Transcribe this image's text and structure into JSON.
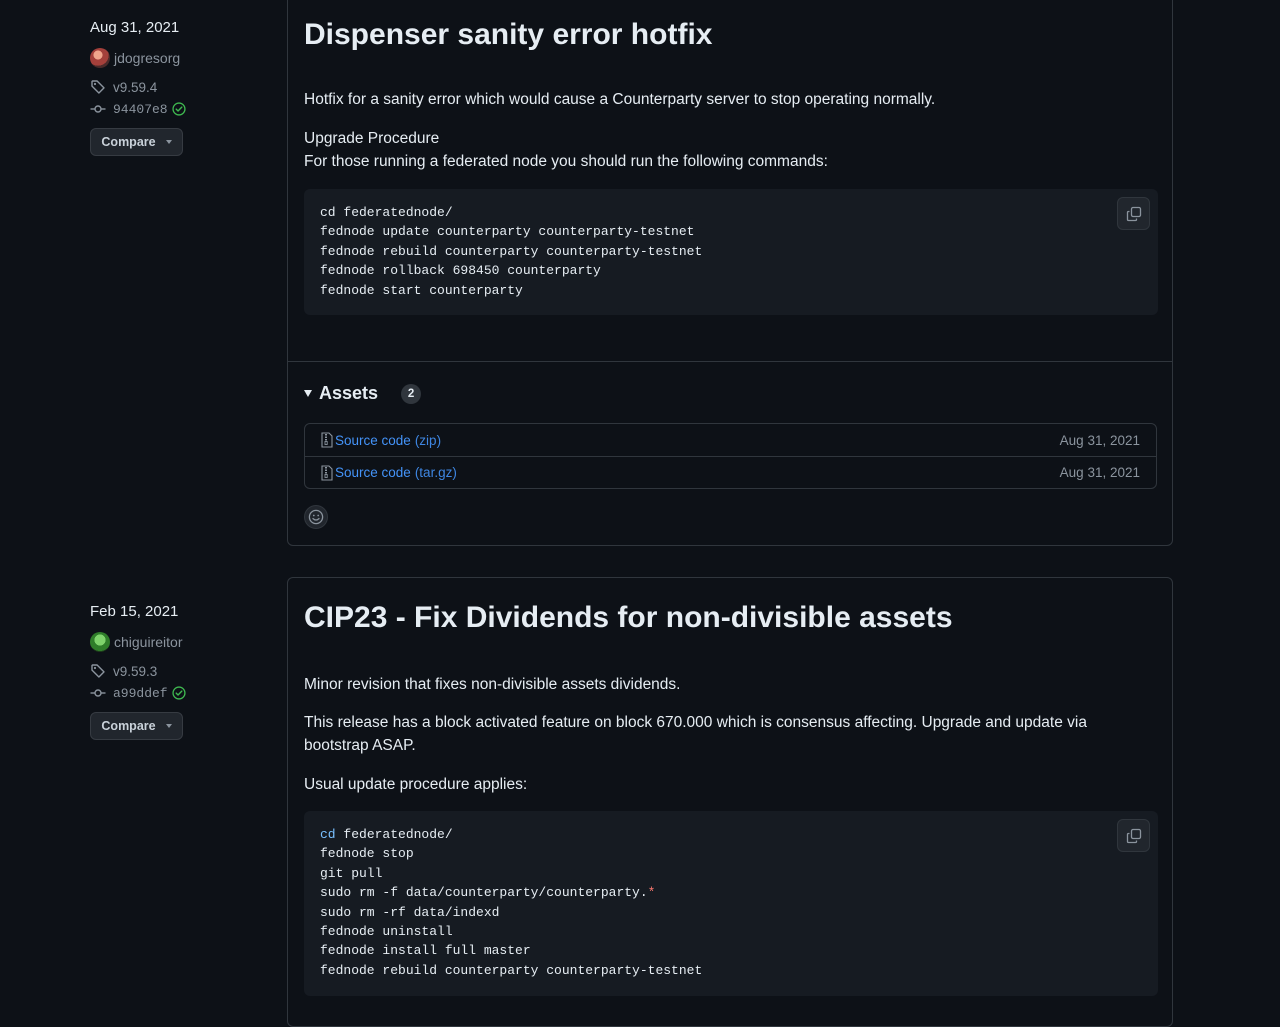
{
  "releases": [
    {
      "date": "Aug 31, 2021",
      "author": "jdogresorg",
      "tag": "v9.59.4",
      "commit": "94407e8",
      "compare_label": "Compare",
      "title": "Dispenser sanity error hotfix",
      "paragraphs": [
        "Hotfix for a sanity error which would cause a Counterparty server to stop operating normally.",
        "Upgrade Procedure",
        "For those running a federated node you should run the following commands:"
      ],
      "code_lines": [
        "cd federatednode/",
        "fednode update counterparty counterparty-testnet",
        "fednode rebuild counterparty counterparty-testnet",
        "fednode rollback 698450 counterparty",
        "fednode start counterparty"
      ],
      "assets_title": "Assets",
      "assets_count": "2",
      "assets": [
        {
          "name": "Source code",
          "ext": "(zip)",
          "date": "Aug 31, 2021"
        },
        {
          "name": "Source code",
          "ext": "(tar.gz)",
          "date": "Aug 31, 2021"
        }
      ]
    },
    {
      "date": "Feb 15, 2021",
      "author": "chiguireitor",
      "tag": "v9.59.3",
      "commit": "a99ddef",
      "compare_label": "Compare",
      "title": "CIP23 - Fix Dividends for non-divisible assets",
      "paragraphs": [
        "Minor revision that fixes non-divisible assets dividends.",
        "This release has a block activated feature on block 670.000 which is consensus affecting. Upgrade and update via bootstrap ASAP.",
        "Usual update procedure applies:"
      ],
      "code_lines": [
        {
          "cmd": "cd",
          "rest": " federatednode/"
        },
        {
          "cmd": "",
          "rest": "fednode stop"
        },
        {
          "cmd": "",
          "rest": "git pull"
        },
        {
          "cmd": "",
          "rest": "sudo rm -f data/counterparty/counterparty.",
          "tail": "*"
        },
        {
          "cmd": "",
          "rest": "sudo rm -rf data/indexd"
        },
        {
          "cmd": "",
          "rest": "fednode uninstall"
        },
        {
          "cmd": "",
          "rest": "fednode install full master"
        },
        {
          "cmd": "",
          "rest": "fednode rebuild counterparty counterparty-testnet"
        }
      ]
    }
  ],
  "colors": {
    "background": "#0d1117",
    "link": "#4493f8",
    "verified": "#3fb950",
    "muted": "#8b949e"
  }
}
